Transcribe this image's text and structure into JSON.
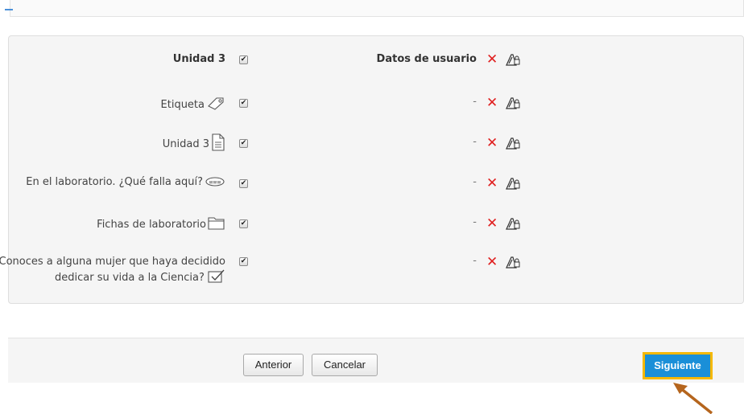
{
  "rows": [
    {
      "label": "Unidad 3",
      "icon": "none",
      "checked": true,
      "status": "Datos de usuario"
    },
    {
      "label": "Etiqueta",
      "icon": "tag-icon",
      "checked": true,
      "status": "-"
    },
    {
      "label": "Unidad 3",
      "icon": "page-icon",
      "checked": true,
      "status": "-"
    },
    {
      "label": "En el laboratorio. ¿Qué falla aquí?",
      "icon": "url-icon",
      "checked": true,
      "status": "-"
    },
    {
      "label": "Fichas de laboratorio",
      "icon": "folder-icon",
      "checked": true,
      "status": "-"
    },
    {
      "label": "¿Conoces a alguna mujer que haya decidido dedicar su vida a la Ciencia?",
      "icon": "choice-icon",
      "checked": true,
      "status": "-"
    }
  ],
  "row_actions": {
    "delete_icon": "delete-x-icon",
    "lock_icon": "edit-lock-icon",
    "delete_color": "#e02020"
  },
  "buttons": {
    "previous": "Anterior",
    "cancel": "Cancelar",
    "next": "Siguiente"
  },
  "colors": {
    "next_button": "#1a8fd8",
    "highlight": "#f5b800",
    "arrow": "#b5651d"
  }
}
